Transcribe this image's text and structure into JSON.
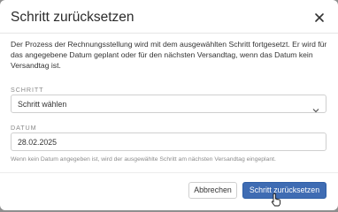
{
  "dialog": {
    "title": "Schritt zurücksetzen",
    "close_icon": "close-icon",
    "description": "Der Prozess der Rechnungsstellung wird mit dem ausgewählten Schritt fortgesetzt. Er wird für das angegebene Datum geplant oder für den nächsten Versandtag, wenn das Datum kein Versandtag ist.",
    "step": {
      "label": "SCHRITT",
      "selected": "Schritt wählen",
      "icon": "chevron-down-icon"
    },
    "date": {
      "label": "DATUM",
      "value": "28.02.2025",
      "hint": "Wenn kein Datum angegeben ist, wird der ausgewählte Schritt am nächsten Versandtag eingeplant."
    },
    "buttons": {
      "cancel": "Abbrechen",
      "confirm": "Schritt zurücksetzen"
    }
  },
  "colors": {
    "primary": "#3f6cb3",
    "backdrop": "#8f8f8f"
  }
}
